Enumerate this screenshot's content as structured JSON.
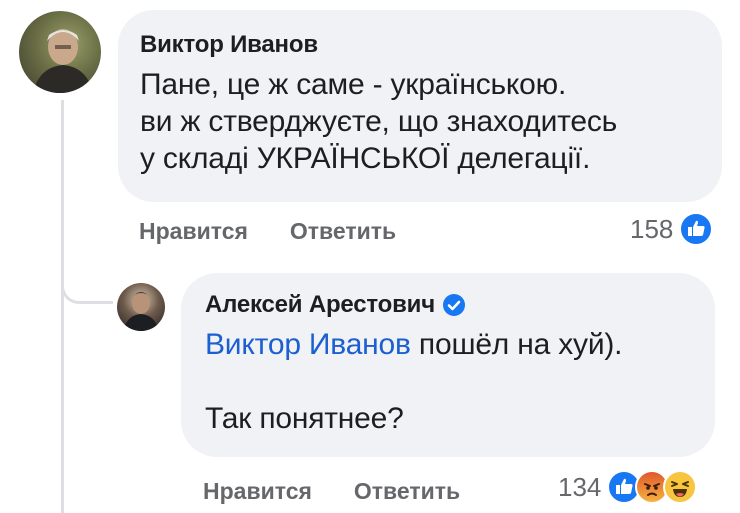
{
  "comment": {
    "author": "Виктор Иванов",
    "lines": [
      "Пане, це ж саме - українською.",
      "ви ж стверджуєте, що знаходитесь",
      "у складі УКРАЇНСЬКОЇ делегації."
    ],
    "actions": {
      "like_label": "Нравится",
      "reply_label": "Ответить"
    },
    "reaction_count": "158",
    "reactions": [
      "like-icon"
    ]
  },
  "reply": {
    "author": "Алексей Арестович",
    "verified": true,
    "mention": "Виктор Иванов",
    "line1_rest": " пошёл на хуй).",
    "line2": "Так понятнее?",
    "actions": {
      "like_label": "Нравится",
      "reply_label": "Ответить"
    },
    "reaction_count": "134",
    "reactions": [
      "like-icon",
      "angry-icon",
      "haha-icon"
    ]
  },
  "colors": {
    "bubble": "#f0f2f5",
    "link": "#1b5fd1",
    "meta": "#65676b",
    "like_blue": "#1877f2"
  }
}
